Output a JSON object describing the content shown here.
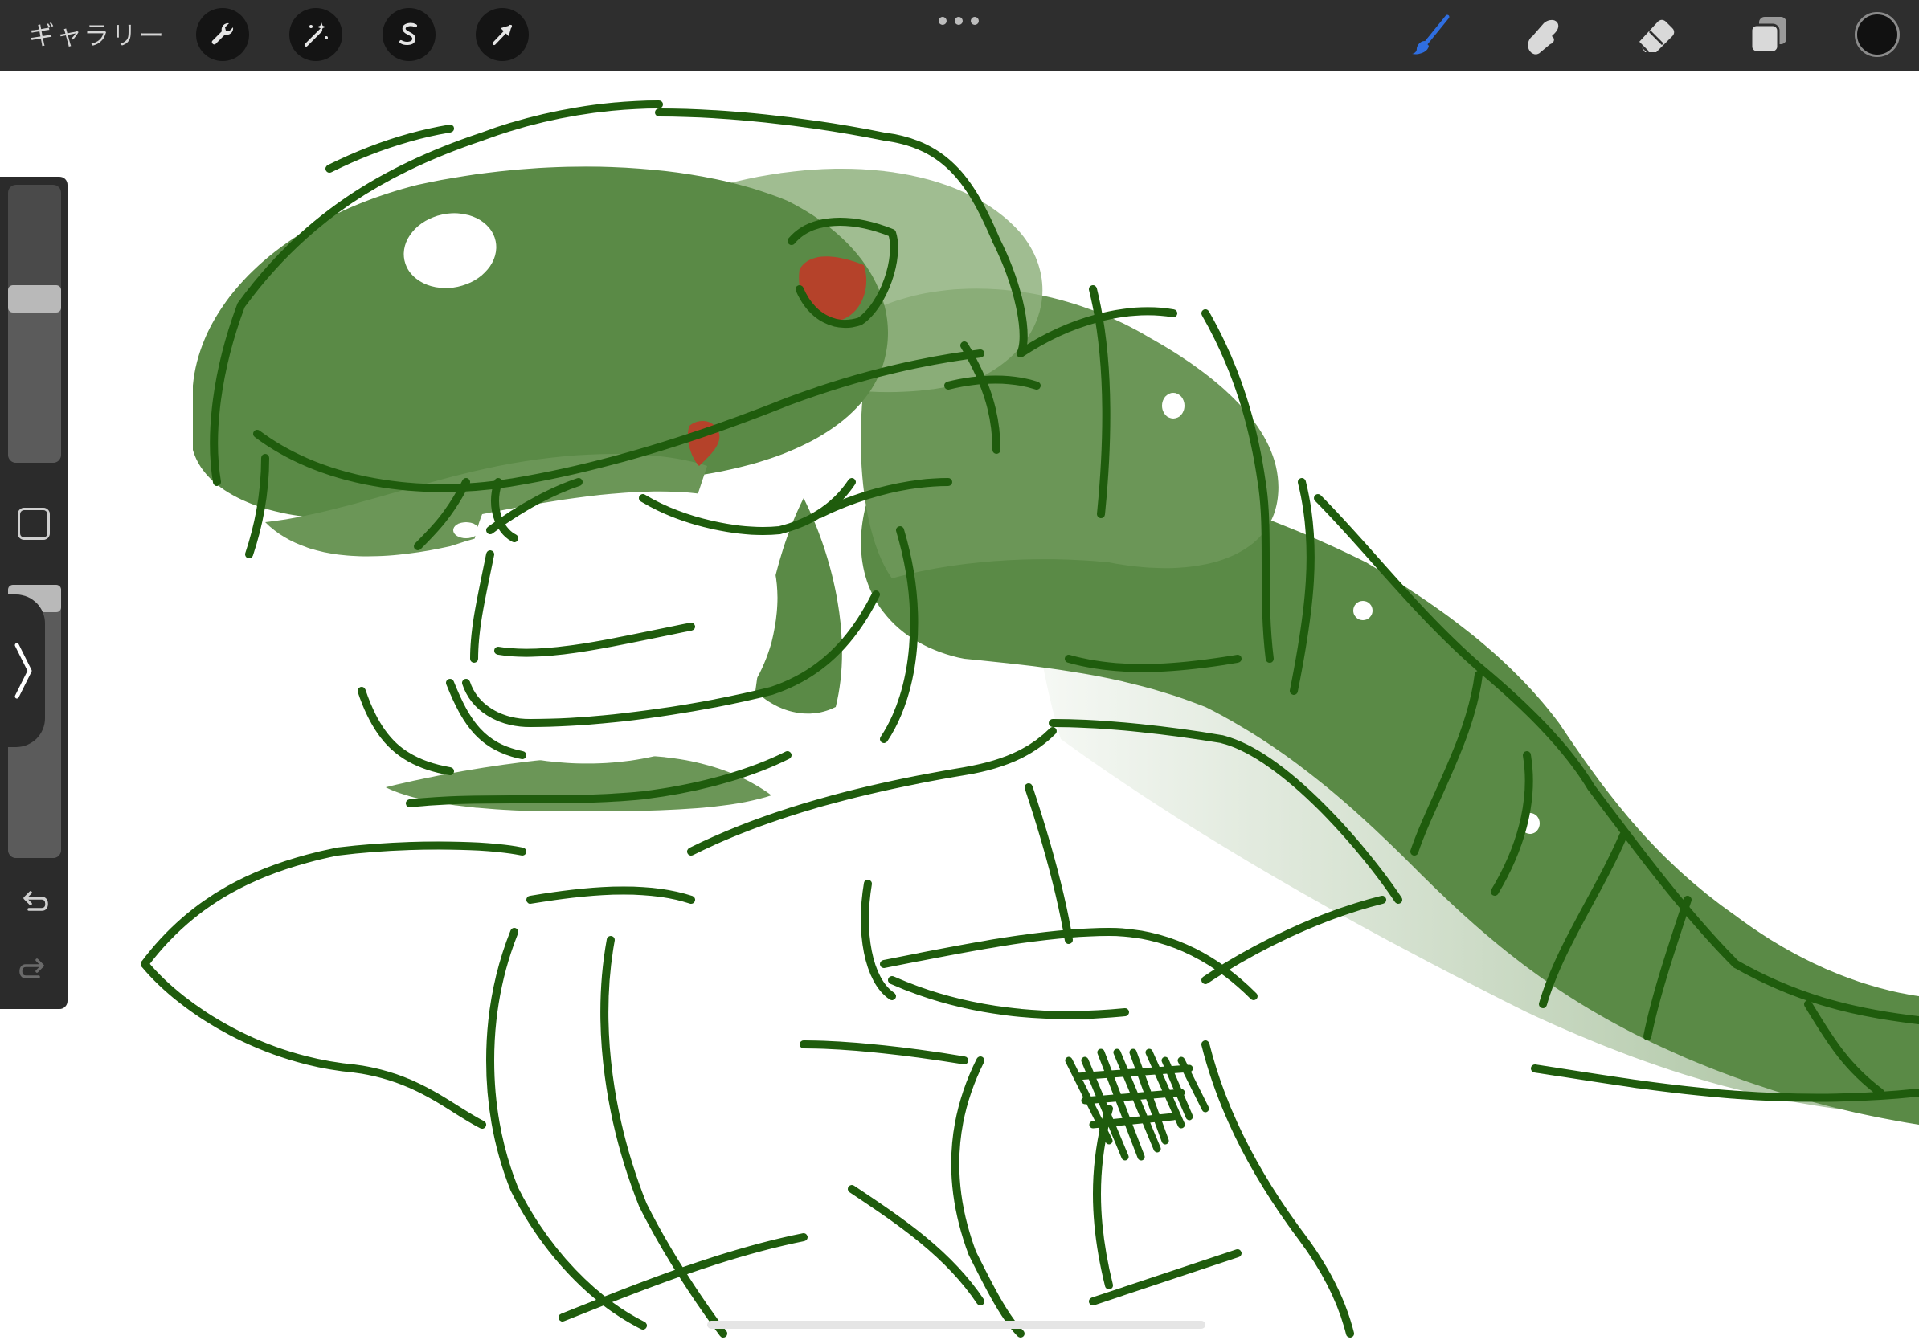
{
  "topbar": {
    "gallery_label": "ギャラリー",
    "left_tools": [
      {
        "name": "actions",
        "icon": "wrench-icon"
      },
      {
        "name": "adjustments",
        "icon": "magic-wand-icon"
      },
      {
        "name": "selection",
        "icon": "selection-s-icon"
      },
      {
        "name": "transform",
        "icon": "arrow-cursor-icon"
      }
    ],
    "more_icon": "more-dots-icon",
    "right_tools": [
      {
        "name": "brush",
        "icon": "brush-icon",
        "active": true
      },
      {
        "name": "smudge",
        "icon": "smudge-finger-icon",
        "active": false
      },
      {
        "name": "eraser",
        "icon": "eraser-icon",
        "active": false
      },
      {
        "name": "layers",
        "icon": "layers-icon",
        "active": false
      }
    ],
    "current_color": "#111111"
  },
  "sidebar": {
    "brush_size_level": 0.6,
    "brush_opacity_level": 1.0,
    "modify_icon": "square-modify-icon",
    "collapse_icon": "chevron-right-icon",
    "undo_icon": "undo-icon",
    "redo_icon": "redo-icon"
  },
  "colors": {
    "ui_dark": "#2e2e2e",
    "active_brush": "#2f6ee0",
    "ink": "#1f5c0d",
    "snake_fill": "#5a8a46",
    "snake_fill_light": "#8fb27e",
    "eye_red": "#c0392b"
  }
}
